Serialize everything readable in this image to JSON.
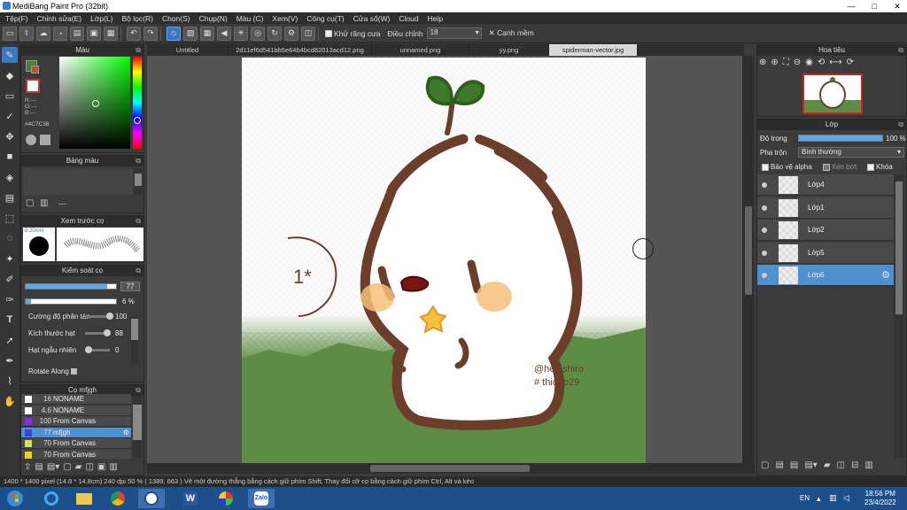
{
  "window": {
    "title": "MediBang Paint Pro (32bit)",
    "min": "—",
    "max": "□",
    "close": "✕"
  },
  "menu": [
    "Tệp(F)",
    "Chỉnh sửa(E)",
    "Lớp(L)",
    "Bộ lọc(R)",
    "Chọn(S)",
    "Chụp(N)",
    "Màu (C)",
    "Xem(V)",
    "Công cụ(T)",
    "Cửa sổ(W)",
    "Cloud",
    "Help"
  ],
  "toolbar": {
    "antialias": "Khử răng cưa",
    "adjust": "Điều chỉnh",
    "adjust_value": "18",
    "smooth": "Cạnh mềm"
  },
  "color_panel": {
    "title": "Màu",
    "hex": "#4C7C38",
    "r": "R:---",
    "g": "G:---",
    "b": "B:---",
    "colors": {
      "fg": "#4c7c38",
      "bg": "#b5553a"
    }
  },
  "palette_panel": {
    "title": "Bảng màu",
    "dash": "---"
  },
  "brush_preview": {
    "title": "Xem trước cọ",
    "size": "8.20mm"
  },
  "brush_control": {
    "title": "Kiểm soát cọ",
    "size_value": "77",
    "opacity_value": "6 %",
    "size_fill": 0.9,
    "opacity_fill": 0.06,
    "rows": [
      {
        "label": "Cường độ phân tán",
        "value": "100",
        "fill": 1.0
      },
      {
        "label": "Kích thước hạt",
        "value": "88",
        "fill": 0.88
      },
      {
        "label": "Hạt ngẫu nhiên",
        "value": "0",
        "fill": 0.0
      }
    ],
    "rotate": "Rotate Along"
  },
  "brush_list": {
    "title": "Cọ mfjgh",
    "items": [
      {
        "n": "16",
        "label": "NONAME",
        "color": "#ffffff",
        "selected": false
      },
      {
        "n": "4.6",
        "label": "NONAME",
        "color": "#ffffff",
        "selected": false
      },
      {
        "n": "100",
        "label": "From Canvas",
        "color": "#8a2be2",
        "selected": false
      },
      {
        "n": "77",
        "label": "mfjgh",
        "color": "#4040e0",
        "selected": true
      },
      {
        "n": "70",
        "label": "From Canvas",
        "color": "#d4e060",
        "selected": false
      },
      {
        "n": "70",
        "label": "From Canvas",
        "color": "#f0d020",
        "selected": false
      }
    ]
  },
  "tabs": [
    {
      "label": "Untitled",
      "active": false
    },
    {
      "label": "2d11ef6d541bb5e64b4bcd82013acd12.png",
      "active": false
    },
    {
      "label": "unnamed.png",
      "active": false
    },
    {
      "label": "yy.png",
      "active": false
    },
    {
      "label": "spiderman-vector.jpg",
      "active": true
    }
  ],
  "canvas": {
    "sig1": "@hebishiro",
    "sig2": "# thidap29",
    "doodle": "1*"
  },
  "navigator": {
    "title": "Hoa tiêu"
  },
  "layer_panel": {
    "title": "Lớp",
    "opacity_label": "Độ trong",
    "opacity_value": "100 %",
    "opacity_fill": 1.0,
    "blend_label": "Pha trộn",
    "blend_value": "Bình thường",
    "protect_alpha": "Bảo vệ alpha",
    "clip": "Xén bớt",
    "lock": "Khóa",
    "layers": [
      {
        "name": "Lớp4",
        "selected": false
      },
      {
        "name": "Lớp1",
        "selected": false
      },
      {
        "name": "Lớp2",
        "selected": false
      },
      {
        "name": "Lớp5",
        "selected": false
      },
      {
        "name": "Lớp6",
        "selected": true
      }
    ]
  },
  "status": "1400 * 1400 pixel   (14.8 * 14.8cm)   240 dpi   50 %   ( 1389, 663 )   Vẽ một đường thẳng bằng cách giữ phím Shift, Thay đổi cỡ cọ bằng cách giữ phím Ctrl, Alt và kéo",
  "taskbar": {
    "lang": "EN",
    "time": "18:56 PM",
    "date": "23/4/2022"
  }
}
